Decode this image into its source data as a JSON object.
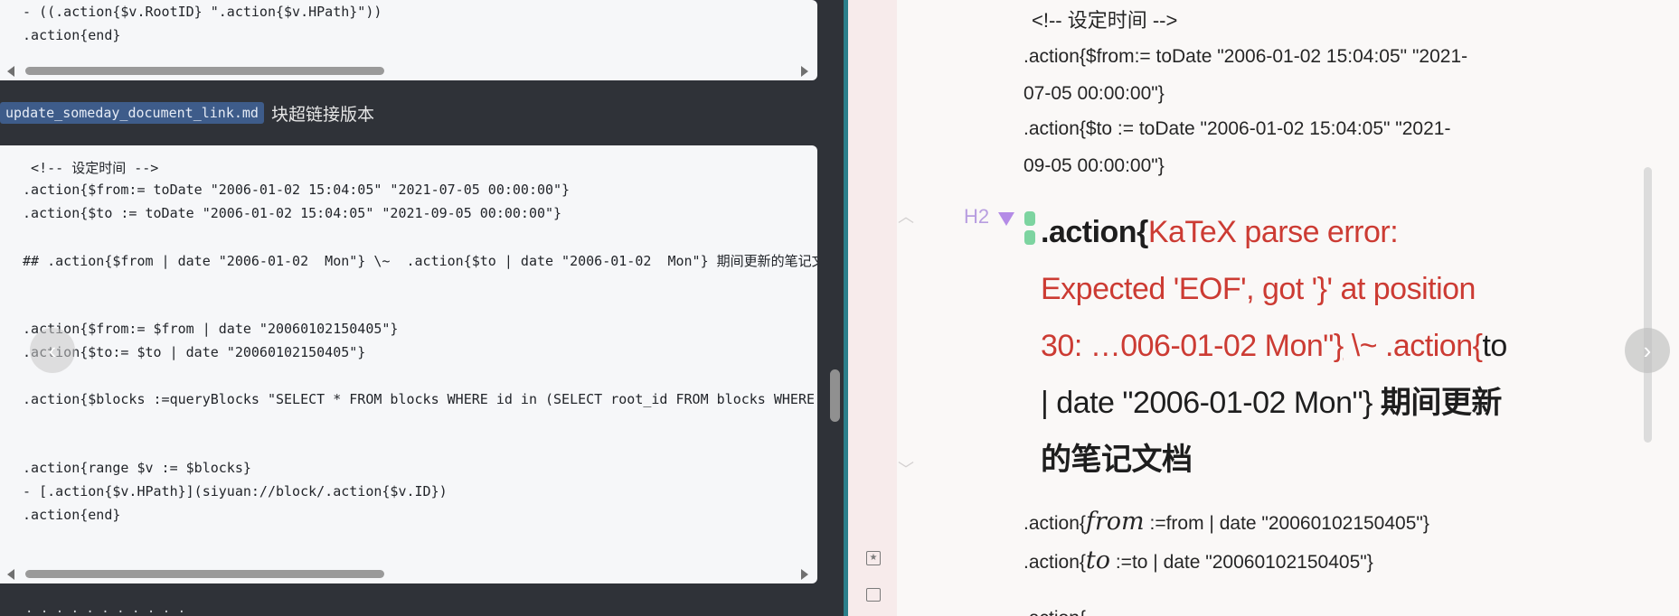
{
  "left_pane": {
    "top_code": {
      "lines": [
        " - ((.action{$v.RootID} \".action{$v.HPath}\"))",
        " .action{end}"
      ]
    },
    "doc_header": {
      "link_text": "update_someday_document_link.md",
      "suffix": "块超链接版本"
    },
    "main_code": {
      "lines": [
        "  <!-- 设定时间 -->",
        " .action{$from:= toDate \"2006-01-02 15:04:05\" \"2021-07-05 00:00:00\"}",
        " .action{$to := toDate \"2006-01-02 15:04:05\" \"2021-09-05 00:00:00\"}",
        " ## .action{$from | date \"2006-01-02  Mon\"} \\~  .action{$to | date \"2006-01-02  Mon\"} 期间更新的笔记文档",
        " .action{$from:= $from | date \"20060102150405\"}",
        " .action{$to:= $to | date \"20060102150405\"}",
        " .action{$blocks :=queryBlocks \"SELECT * FROM blocks WHERE id in (SELECT root_id FROM blocks WHERE",
        " .action{range $v := $blocks}",
        " - [.action{$v.HPath}](siyuan://block/.action{$v.ID})",
        " .action{end}"
      ]
    },
    "bottom_stub": "· · · · · · · · · · ·"
  },
  "right_pane": {
    "comment": "<!-- 设定时间 -->",
    "from_line": ".action{$from:= toDate \"2006-01-02 15:04:05\" \"2021-07-05 00:00:00\"}",
    "to_line": ".action{$to := toDate \"2006-01-02 15:04:05\" \"2021-09-05 00:00:00\"}",
    "heading_badge": "H2",
    "heading": {
      "prefix": ".action{",
      "error": "KaTeX parse error: Expected 'EOF', got '}' at position 30: …006-01-02  Mon\"",
      "error_brace": "}",
      "error_tail": " \\~  .action{",
      "plain": "to | date \"2006-01-02  Mon\"} ",
      "bold_tail": "期间更新的笔记文档"
    },
    "math_from": {
      "prefix": ".action{",
      "var": "from",
      "op": " :=",
      "rest": "from | date \"20060102150405\"}"
    },
    "math_to": {
      "prefix": ".action{",
      "var": "to",
      "op": " :=",
      "rest": "to | date \"20060102150405\"}"
    },
    "cut_line": ".action{"
  },
  "icons": {
    "nav_prev": "chevron-left-icon",
    "nav_next": "chevron-right-icon",
    "fold": "triangle-down-icon",
    "drag": "drag-handle-icon",
    "bookmark": "bookmark-icon",
    "panel": "panel-icon"
  },
  "colors": {
    "divider_accent": "#2b7e8a",
    "katex_error": "#cc3b33",
    "heading_badge": "#b89ee0",
    "drag_handle": "#7dd4a0",
    "doc_link_bg": "#3e5c8a"
  }
}
